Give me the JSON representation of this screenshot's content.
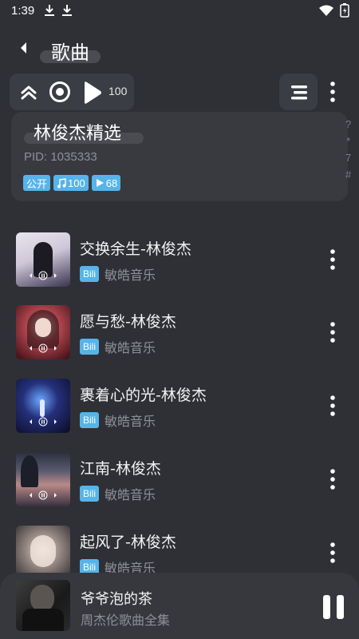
{
  "status": {
    "time": "1:39",
    "icons": [
      "download-icon",
      "download-icon",
      "wifi-icon",
      "battery-icon"
    ]
  },
  "header": {
    "title": "歌曲",
    "back_icon": "back-icon"
  },
  "toolbar": {
    "play_count": "100",
    "icons": [
      "collapse-up-icon",
      "locate-icon",
      "play-icon",
      "sort-list-icon",
      "more-vertical-icon"
    ]
  },
  "playlist": {
    "name": "林俊杰精选",
    "pid": "PID: 1035333",
    "tags": {
      "visibility": "公开",
      "song_count": "100",
      "play_count": "68"
    },
    "index_letters": [
      "?",
      "*",
      "7",
      "#"
    ]
  },
  "songs": [
    {
      "title": "交换余生-林俊杰",
      "source": "Bili",
      "artist": "敏皓音乐"
    },
    {
      "title": "愿与愁-林俊杰",
      "source": "Bili",
      "artist": "敏皓音乐"
    },
    {
      "title": "裹着心的光-林俊杰",
      "source": "Bili",
      "artist": "敏皓音乐"
    },
    {
      "title": "江南-林俊杰",
      "source": "Bili",
      "artist": "敏皓音乐"
    },
    {
      "title": "起风了-林俊杰",
      "source": "Bili",
      "artist": "敏皓音乐"
    }
  ],
  "now_playing": {
    "title": "爷爷泡的茶",
    "subtitle": "周杰伦歌曲全集",
    "state_icon": "pause-icon"
  },
  "colors": {
    "background": "#2e3036",
    "card": "#383a40",
    "accent": "#56b4ea",
    "muted_text": "#8e9097"
  }
}
